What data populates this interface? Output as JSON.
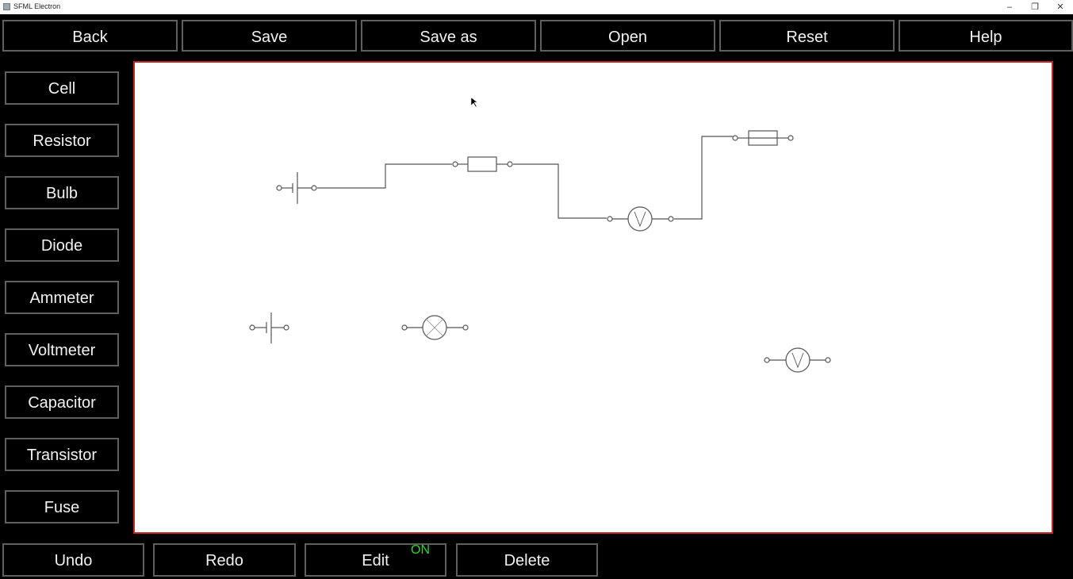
{
  "window": {
    "title": "SFML Electron",
    "controls": {
      "minimize": "–",
      "restore": "❐",
      "close": "✕"
    }
  },
  "toolbar": {
    "back": "Back",
    "save": "Save",
    "save_as": "Save as",
    "open": "Open",
    "reset": "Reset",
    "help": "Help"
  },
  "components": [
    "Cell",
    "Resistor",
    "Bulb",
    "Diode",
    "Ammeter",
    "Voltmeter",
    "Capacitor",
    "Transistor",
    "Fuse"
  ],
  "bottom_bar": {
    "undo": "Undo",
    "redo": "Redo",
    "edit": "Edit",
    "edit_state": "ON",
    "delete": "Delete"
  },
  "colors": {
    "canvas_border": "#c0272d",
    "button_border": "#5f5f5f",
    "edit_on": "#2fd42f"
  },
  "circuit": {
    "placed_components": [
      {
        "type": "cell",
        "label": "cell-1"
      },
      {
        "type": "resistor",
        "label": "resistor-1"
      },
      {
        "type": "voltmeter",
        "label": "voltmeter-1",
        "symbol": "V"
      },
      {
        "type": "fuse",
        "label": "fuse-1"
      },
      {
        "type": "cell",
        "label": "cell-2"
      },
      {
        "type": "bulb",
        "label": "bulb-1"
      },
      {
        "type": "voltmeter",
        "label": "voltmeter-2",
        "symbol": "V"
      }
    ]
  }
}
